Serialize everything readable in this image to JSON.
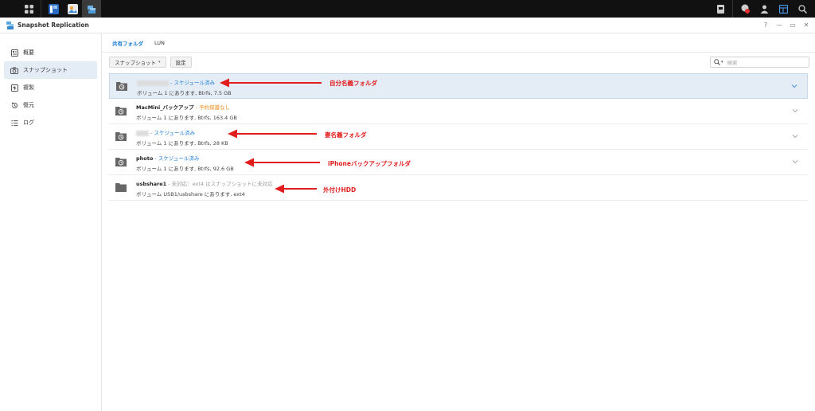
{
  "window": {
    "title": "Snapshot Replication",
    "controls": [
      "?",
      "—",
      "▭",
      "✕"
    ]
  },
  "sidebar": {
    "items": [
      {
        "label": "概要",
        "icon": "overview-icon"
      },
      {
        "label": "スナップショット",
        "icon": "camera-icon"
      },
      {
        "label": "複製",
        "icon": "replication-icon"
      },
      {
        "label": "復元",
        "icon": "restore-icon"
      },
      {
        "label": "ログ",
        "icon": "log-icon"
      }
    ]
  },
  "tabs": [
    {
      "label": "共有フォルダ"
    },
    {
      "label": "LUN"
    }
  ],
  "toolbar": {
    "snapshot_label": "スナップショット",
    "settings_label": "設定",
    "search_placeholder": "検索"
  },
  "folders": [
    {
      "name": "",
      "status": "- スケジュール済み",
      "status_color": "#1d7cd6",
      "detail": "ボリューム 1 にあります, Btrfs, 7.5 GB"
    },
    {
      "name": "MacMini_バックアップ",
      "status": "- 予約保護なし",
      "status_color": "#f08c1f",
      "detail": "ボリューム 1 にあります, Btrfs, 163.4 GB"
    },
    {
      "name": "",
      "status": "- スケジュール済み",
      "status_color": "#1d7cd6",
      "detail": "ボリューム 1 にあります, Btrfs, 28 KB"
    },
    {
      "name": "photo",
      "status": "- スケジュール済み",
      "status_color": "#1d7cd6",
      "detail": "ボリューム 1 にあります, Btrfs, 92.6 GB"
    },
    {
      "name": "usbshare1",
      "status": "- 未対応：ext4 はスナップショットに未対応",
      "status_color": "#999999",
      "detail": "ボリューム USB1/usbshare にあります, ext4"
    }
  ],
  "annotations": [
    {
      "text": "自分名義フォルダ"
    },
    {
      "text": "妻名義フォルダ"
    },
    {
      "text": "iPhoneバックアップフォルダ"
    },
    {
      "text": "外付けHDD"
    }
  ],
  "colors": {
    "accent": "#1d7cd6",
    "annotation": "#e21d1d",
    "selected_row": "#e4ecf6"
  }
}
